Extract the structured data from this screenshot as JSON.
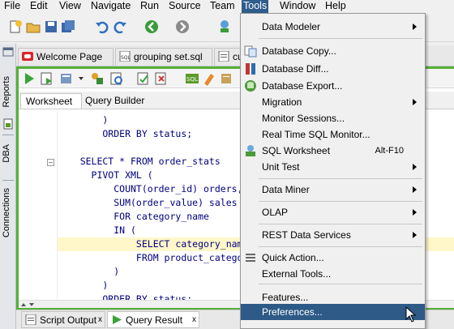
{
  "menubar": {
    "items": [
      "File",
      "Edit",
      "View",
      "Navigate",
      "Run",
      "Source",
      "Team",
      "Tools",
      "Window",
      "Help"
    ],
    "active": "Tools"
  },
  "side_panel": {
    "labels": [
      "Reports",
      "DBA",
      "Connections"
    ]
  },
  "editor_tabs": {
    "tabs": [
      {
        "label": "Welcome Page"
      },
      {
        "label": "grouping set.sql"
      },
      {
        "label": "cu"
      }
    ]
  },
  "worksheet_tabs": {
    "worksheet": "Worksheet",
    "query_builder": "Query Builder"
  },
  "code": {
    "lines": [
      "        )",
      "        ORDER BY status;",
      "",
      "    SELECT * FROM order_stats",
      "      PIVOT XML (",
      "          COUNT(order_id) orders,",
      "          SUM(order_value) sales",
      "          FOR category_name",
      "          IN (",
      "              SELECT category_name",
      "              FROM product_categori",
      "          )",
      "        )",
      "        ORDER BY status;"
    ]
  },
  "bottom_tabs": {
    "script_output": "Script Output",
    "query_result": "Query Result",
    "close": "x"
  },
  "tools_menu": {
    "items": [
      {
        "label": "Data Modeler",
        "submenu": true
      },
      {
        "label": "Database Copy..."
      },
      {
        "label": "Database Diff..."
      },
      {
        "label": "Database Export..."
      },
      {
        "label": "Migration",
        "submenu": true
      },
      {
        "label": "Monitor Sessions..."
      },
      {
        "label": "Real Time SQL Monitor..."
      },
      {
        "label": "SQL Worksheet",
        "shortcut": "Alt-F10"
      },
      {
        "label": "Unit Test",
        "submenu": true
      },
      {
        "label": "Data Miner",
        "submenu": true
      },
      {
        "label": "OLAP",
        "submenu": true
      },
      {
        "label": "REST Data Services",
        "submenu": true
      },
      {
        "label": "Quick Action..."
      },
      {
        "label": "External Tools..."
      },
      {
        "label": "Features..."
      },
      {
        "label": "Preferences...",
        "selected": true
      }
    ]
  },
  "colors": {
    "menu_highlight": "#2e5a87",
    "editor_frame": "#55b03a",
    "code_text": "#00007f",
    "code_function": "#7a1f5c",
    "current_line": "#fff7c9"
  }
}
